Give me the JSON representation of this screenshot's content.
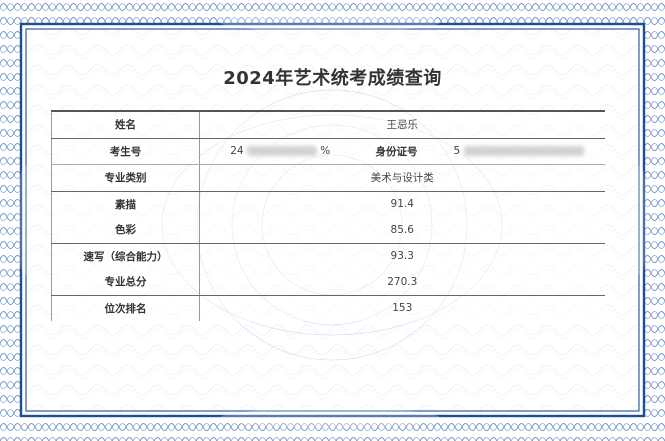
{
  "page": {
    "title": "2024年艺术统考成绩查询"
  },
  "colors": {
    "border_dark": "#2b5595",
    "border_light": "#6d93c7",
    "pattern": "#9fb8dd",
    "text": "#333333"
  },
  "record": {
    "name_label": "姓名",
    "name_value": "王忌乐",
    "exam_no_label": "考生号",
    "exam_no_visible": "24",
    "exam_no_tail": "%",
    "id_label": "身份证号",
    "id_visible": "5",
    "category_label": "专业类别",
    "category_value": "美术与设计类",
    "sketch_label": "素描",
    "sketch_value": "91.4",
    "color_label": "色彩",
    "color_value": "85.6",
    "speed_label": "速写（综合能力）",
    "speed_value": "93.3",
    "total_label": "专业总分",
    "total_value": "270.3",
    "rank_label": "位次排名",
    "rank_value": "153"
  }
}
